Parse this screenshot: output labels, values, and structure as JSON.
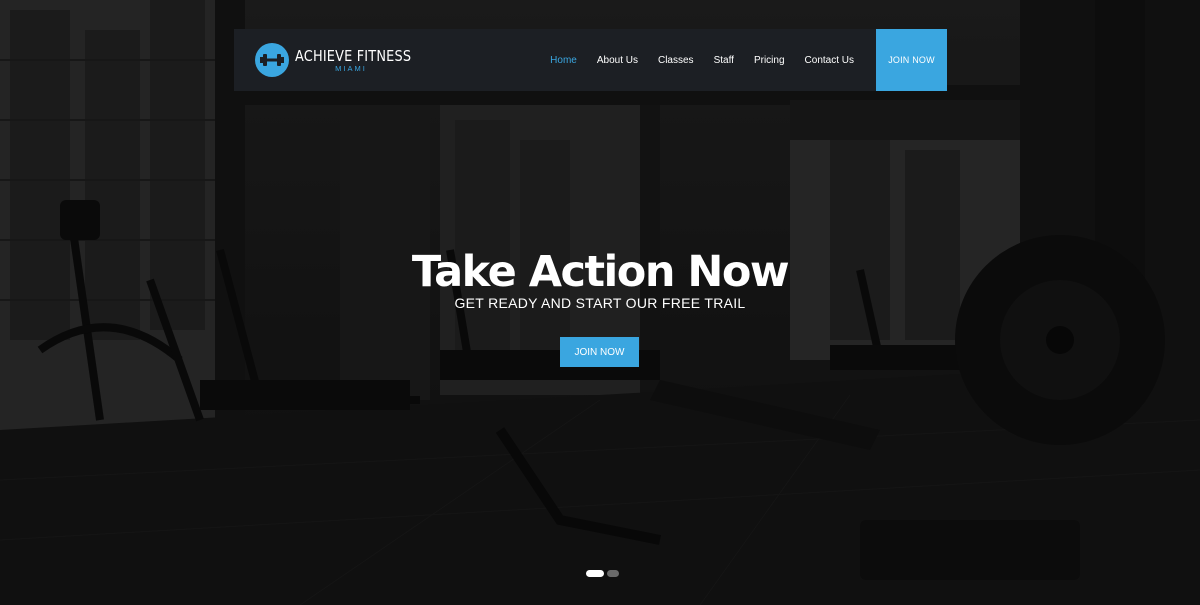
{
  "brand": {
    "name": "ACHIEVE FITNESS",
    "subtitle": "MIAMI",
    "logo_icon": "dumbbell-icon",
    "accent_color": "#3aa6e0"
  },
  "nav": {
    "items": [
      {
        "label": "Home",
        "active": true
      },
      {
        "label": "About Us",
        "active": false
      },
      {
        "label": "Classes",
        "active": false
      },
      {
        "label": "Staff",
        "active": false
      },
      {
        "label": "Pricing",
        "active": false
      },
      {
        "label": "Contact Us",
        "active": false
      }
    ],
    "cta_label": "JOIN NOW"
  },
  "hero": {
    "title": "Take Action Now",
    "subtitle": "GET READY AND START OUR FREE TRAIL",
    "button_label": "JOIN NOW"
  },
  "slider": {
    "slide_count": 2,
    "active_index": 0
  }
}
